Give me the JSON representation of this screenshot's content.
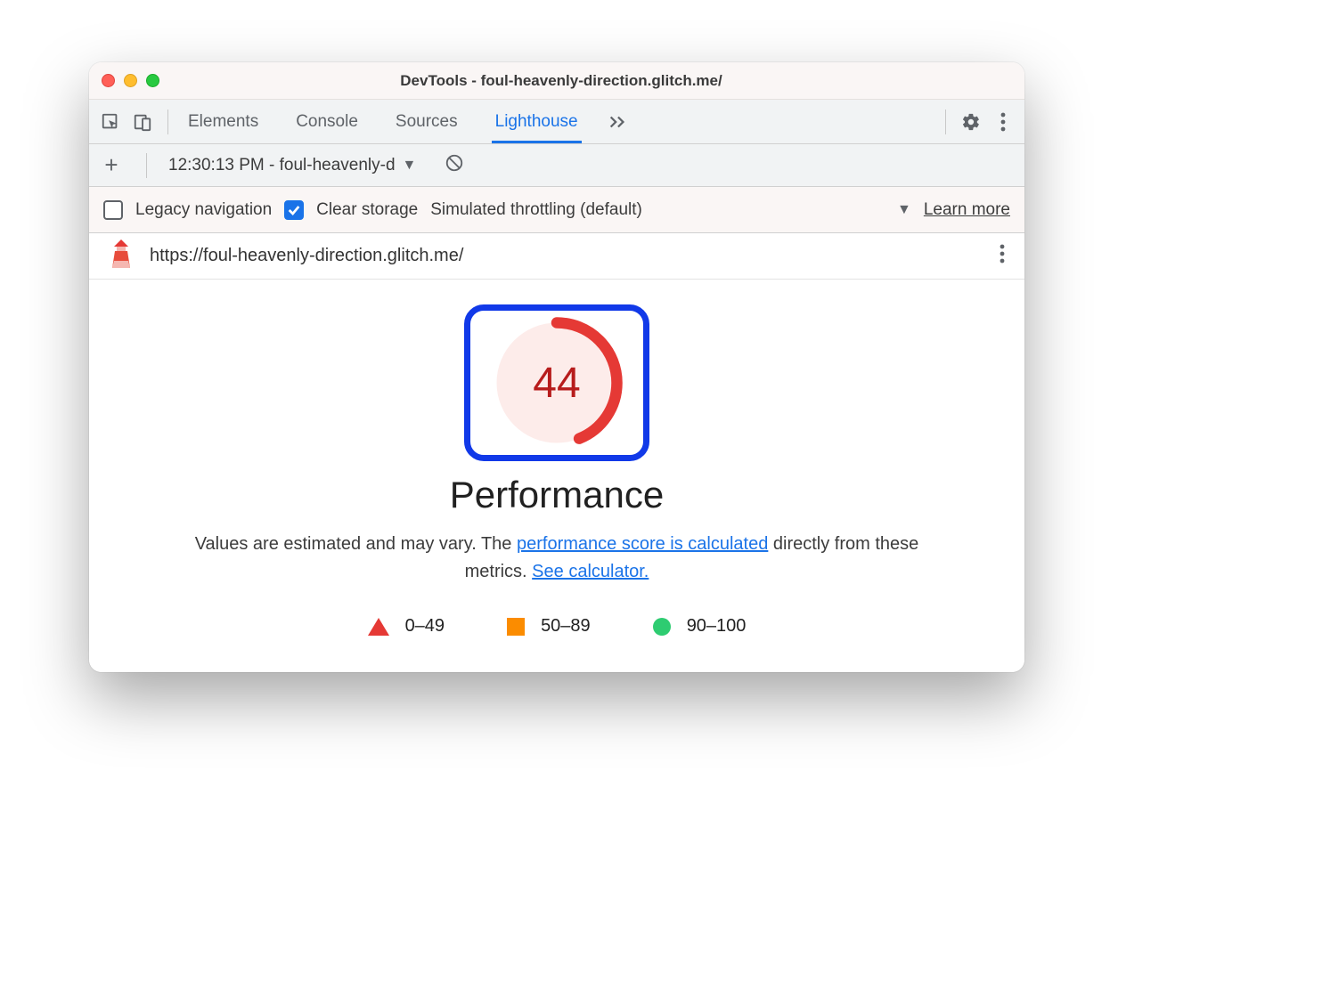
{
  "window": {
    "title": "DevTools - foul-heavenly-direction.glitch.me/"
  },
  "tabs": {
    "items": [
      "Elements",
      "Console",
      "Sources",
      "Lighthouse"
    ],
    "active": "Lighthouse"
  },
  "report_select": {
    "label": "12:30:13 PM - foul-heavenly-d"
  },
  "settings": {
    "legacy_label": "Legacy navigation",
    "legacy_checked": false,
    "clear_label": "Clear storage",
    "clear_checked": true,
    "throttle_label": "Simulated throttling (default)",
    "learn_more": "Learn more"
  },
  "url": "https://foul-heavenly-direction.glitch.me/",
  "report": {
    "score": 44,
    "title": "Performance",
    "desc_prefix": "Values are estimated and may vary. The ",
    "link1": "performance score is calculated",
    "desc_mid": " directly from these metrics. ",
    "link2": "See calculator.",
    "legend": {
      "r": "0–49",
      "o": "50–89",
      "g": "90–100"
    }
  }
}
